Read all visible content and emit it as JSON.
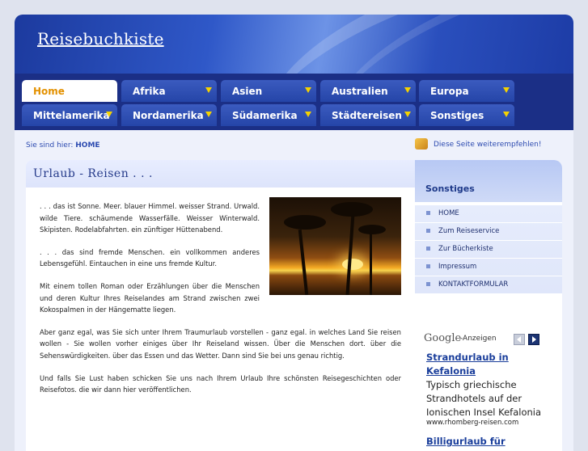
{
  "site": {
    "title": "Reisebuchkiste"
  },
  "nav": {
    "tabs": [
      {
        "label": "Home",
        "active": true
      },
      {
        "label": "Afrika"
      },
      {
        "label": "Asien"
      },
      {
        "label": "Australien"
      },
      {
        "label": "Europa"
      },
      {
        "label": "Mittelamerika"
      },
      {
        "label": "Nordamerika"
      },
      {
        "label": "Südamerika"
      },
      {
        "label": "Städtereisen"
      },
      {
        "label": "Sonstiges"
      }
    ]
  },
  "breadcrumb": {
    "prefix": "Sie sind hier: ",
    "current": "HOME"
  },
  "recommend": {
    "label": "Diese Seite weiterempfehlen!"
  },
  "content": {
    "title": "Urlaub - Reisen . . .",
    "paragraphs": [
      ". . . das ist Sonne. Meer. blauer Himmel. weisser Strand. Urwald. wilde Tiere. schäumende Wasserfälle. Weisser Winterwald. Skipisten. Rodelabfahrten. ein zünftiger Hüttenabend.",
      ". . . das sind fremde Menschen. ein vollkommen anderes Lebensgefühl. Eintauchen in eine uns fremde Kultur.",
      "Mit einem tollen Roman oder Erzählungen über die Menschen und deren Kultur Ihres Reiselandes am Strand zwischen zwei Kokospalmen in der Hängematte liegen.",
      "Aber ganz egal, was Sie sich unter Ihrem Traumurlaub vorstellen - ganz egal. in welches Land Sie reisen wollen - Sie wollen vorher einiges über Ihr Reiseland wissen. Über die Menschen dort. über die Sehenswürdigkeiten. über das Essen und das Wetter. Dann sind Sie bei uns genau richtig.",
      "Und falls Sie Lust haben schicken Sie uns nach Ihrem Urlaub Ihre schönsten Reisegeschichten oder Reisefotos. die wir dann hier veröffentlichen."
    ]
  },
  "sidebar": {
    "title": "Sonstiges",
    "items": [
      {
        "label": "HOME"
      },
      {
        "label": "Zum Reiseservice"
      },
      {
        "label": "Zur Bücherkiste"
      },
      {
        "label": "Impressum"
      },
      {
        "label": "KONTAKTFORMULAR"
      }
    ]
  },
  "ads": {
    "logo": "Google",
    "label": "-Anzeigen",
    "title": "Strandurlaub in Kefalonia",
    "text": "Typisch griechische Strandhotels auf der Ionischen Insel Kefalonia",
    "url": "www.rhomberg-reisen.com",
    "title2": "Billigurlaub für"
  },
  "icons": [
    "arrow-down-icon",
    "recommend-icon",
    "bullet-icon",
    "prev-arrow-icon",
    "next-arrow-icon"
  ],
  "colors": {
    "nav_bg": "#1b2f86",
    "tab_bg": "#2f4fb3",
    "active_tab_text": "#e39100",
    "tab_arrow": "#f5d200",
    "link": "#2d4bb0"
  }
}
